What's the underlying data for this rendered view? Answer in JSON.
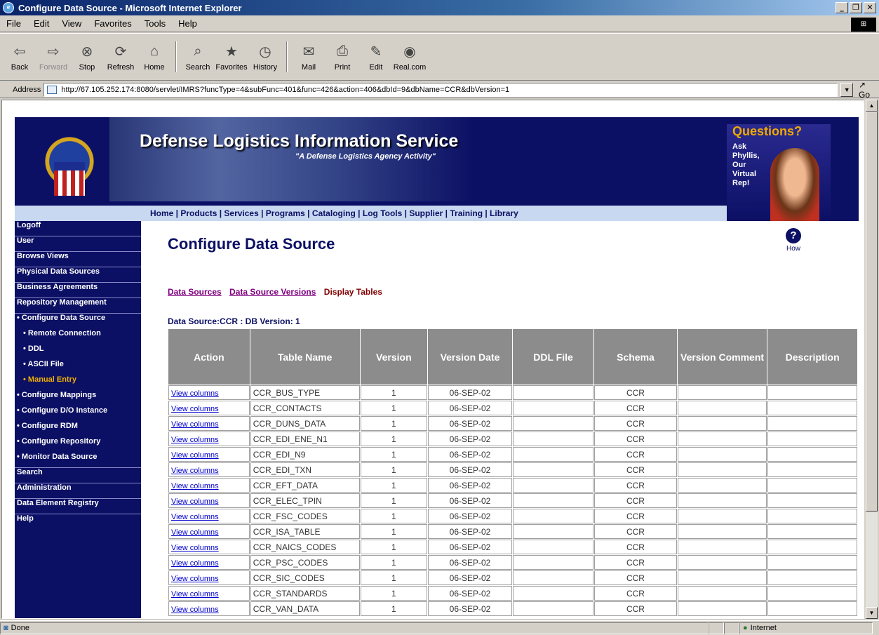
{
  "window": {
    "title": "Configure Data Source - Microsoft Internet Explorer"
  },
  "menu": [
    "File",
    "Edit",
    "View",
    "Favorites",
    "Tools",
    "Help"
  ],
  "toolbar": {
    "back": "Back",
    "forward": "Forward",
    "stop": "Stop",
    "refresh": "Refresh",
    "home": "Home",
    "search": "Search",
    "favorites": "Favorites",
    "history": "History",
    "mail": "Mail",
    "print": "Print",
    "edit": "Edit",
    "real": "Real.com"
  },
  "address": {
    "label": "Address",
    "url": "http://67.105.252.174:8080/servlet/IMRS?funcType=4&subFunc=401&func=426&action=406&dbId=9&dbName=CCR&dbVersion=1",
    "go": "Go"
  },
  "banner": {
    "title": "Defense Logistics Information Service",
    "subtitle": "\"A Defense Logistics Agency Activity\"",
    "questions": "Questions?",
    "ask": "Ask Phyllis, Our Virtual Rep!"
  },
  "topnav": "Home | Products | Services | Programs | Cataloging | Log Tools | Supplier | Training | Library",
  "sidebar": [
    "Logoff",
    "User",
    "Browse Views",
    "Physical Data Sources",
    "Business Agreements",
    "Repository Management",
    "• Configure Data Source",
    "• Remote Connection",
    "• DDL",
    "• ASCII File",
    "• Manual Entry",
    "• Configure Mappings",
    "• Configure D/O Instance",
    "• Configure RDM",
    "• Configure Repository",
    "• Monitor Data Source",
    "Search",
    "Administration",
    "Data Element Registry",
    "Help"
  ],
  "page": {
    "title": "Configure Data Source",
    "how": "How",
    "tabs": {
      "data_sources": "Data Sources",
      "versions": "Data Source Versions",
      "display": "Display Tables"
    },
    "ds_info": "Data Source:CCR  :  DB Version: 1"
  },
  "table": {
    "headers": [
      "Action",
      "Table Name",
      "Version",
      "Version Date",
      "DDL File",
      "Schema",
      "Version Comment",
      "Description"
    ],
    "link": "View columns",
    "rows": [
      [
        "CCR_BUS_TYPE",
        "1",
        "06-SEP-02",
        "",
        "CCR",
        "",
        ""
      ],
      [
        "CCR_CONTACTS",
        "1",
        "06-SEP-02",
        "",
        "CCR",
        "",
        ""
      ],
      [
        "CCR_DUNS_DATA",
        "1",
        "06-SEP-02",
        "",
        "CCR",
        "",
        ""
      ],
      [
        "CCR_EDI_ENE_N1",
        "1",
        "06-SEP-02",
        "",
        "CCR",
        "",
        ""
      ],
      [
        "CCR_EDI_N9",
        "1",
        "06-SEP-02",
        "",
        "CCR",
        "",
        ""
      ],
      [
        "CCR_EDI_TXN",
        "1",
        "06-SEP-02",
        "",
        "CCR",
        "",
        ""
      ],
      [
        "CCR_EFT_DATA",
        "1",
        "06-SEP-02",
        "",
        "CCR",
        "",
        ""
      ],
      [
        "CCR_ELEC_TPIN",
        "1",
        "06-SEP-02",
        "",
        "CCR",
        "",
        ""
      ],
      [
        "CCR_FSC_CODES",
        "1",
        "06-SEP-02",
        "",
        "CCR",
        "",
        ""
      ],
      [
        "CCR_ISA_TABLE",
        "1",
        "06-SEP-02",
        "",
        "CCR",
        "",
        ""
      ],
      [
        "CCR_NAICS_CODES",
        "1",
        "06-SEP-02",
        "",
        "CCR",
        "",
        ""
      ],
      [
        "CCR_PSC_CODES",
        "1",
        "06-SEP-02",
        "",
        "CCR",
        "",
        ""
      ],
      [
        "CCR_SIC_CODES",
        "1",
        "06-SEP-02",
        "",
        "CCR",
        "",
        ""
      ],
      [
        "CCR_STANDARDS",
        "1",
        "06-SEP-02",
        "",
        "CCR",
        "",
        ""
      ],
      [
        "CCR_VAN_DATA",
        "1",
        "06-SEP-02",
        "",
        "CCR",
        "",
        ""
      ]
    ]
  },
  "status": {
    "text": "Done",
    "zone": "Internet"
  },
  "colors": {
    "navy": "#0c1064",
    "active": "#f0b000",
    "header_gray": "#8c8c8c",
    "visited": "#800080"
  }
}
